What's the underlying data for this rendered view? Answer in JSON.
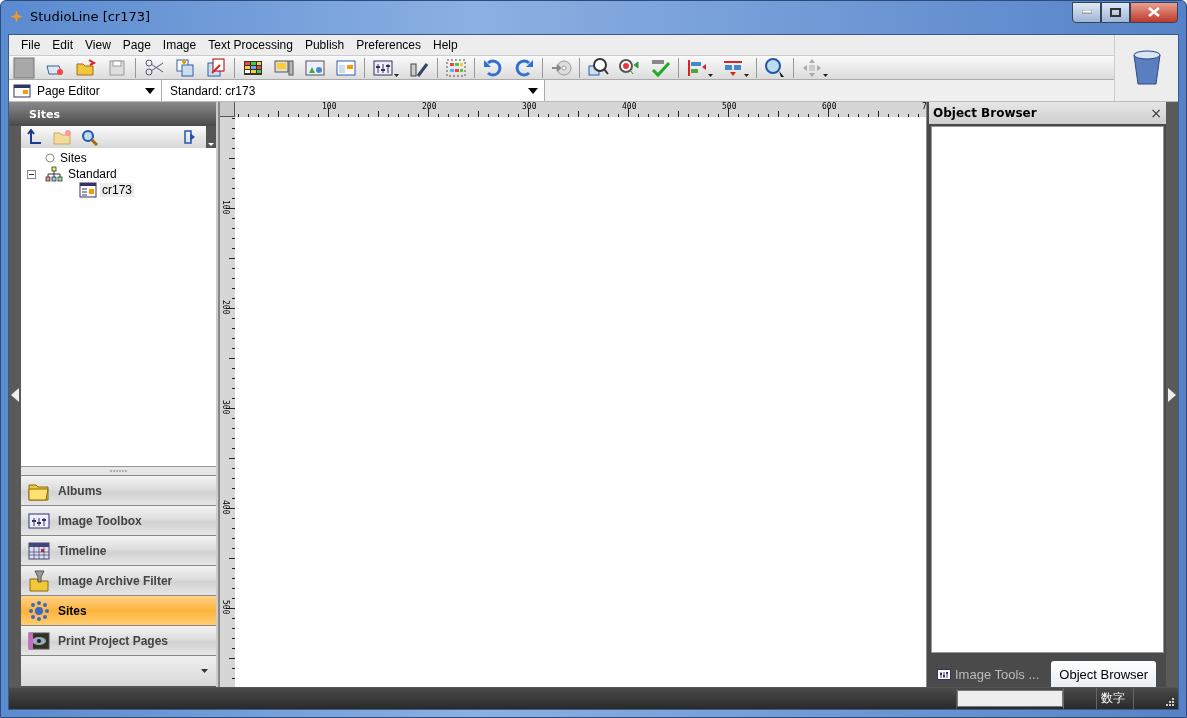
{
  "window": {
    "title": "StudioLine [cr173]"
  },
  "menu": [
    "File",
    "Edit",
    "View",
    "Page",
    "Image",
    "Text Processing",
    "Publish",
    "Preferences",
    "Help"
  ],
  "mode_select": {
    "value": "Page Editor"
  },
  "page_select": {
    "value": "Standard: cr173"
  },
  "sites_panel": {
    "title": "Sites",
    "tree": [
      {
        "label": "Sites",
        "kind": "root",
        "selected": false
      },
      {
        "label": "Standard",
        "kind": "site",
        "selected": false,
        "expanded": true,
        "children": [
          {
            "label": "cr173",
            "kind": "page",
            "selected": true
          }
        ]
      }
    ]
  },
  "navigator": [
    {
      "label": "Albums",
      "kind": "folder",
      "selected": false
    },
    {
      "label": "Image Toolbox",
      "kind": "toolbox",
      "selected": false
    },
    {
      "label": "Timeline",
      "kind": "calendar",
      "selected": false
    },
    {
      "label": "Image Archive Filter",
      "kind": "filter",
      "selected": false
    },
    {
      "label": "Sites",
      "kind": "sites",
      "selected": true
    },
    {
      "label": "Print Project Pages",
      "kind": "print",
      "selected": false
    }
  ],
  "ruler": {
    "horizontal": [
      "100",
      "200",
      "300",
      "400",
      "500",
      "600",
      "7"
    ],
    "vertical": [
      "100",
      "200",
      "300",
      "400",
      "500"
    ]
  },
  "object_browser": {
    "title": "Object Browser",
    "close": "×",
    "tabs": [
      {
        "label": "Image Tools ...",
        "selected": false
      },
      {
        "label": "Object Browser",
        "selected": true
      }
    ]
  },
  "status_bar": {
    "mode": "数字"
  }
}
